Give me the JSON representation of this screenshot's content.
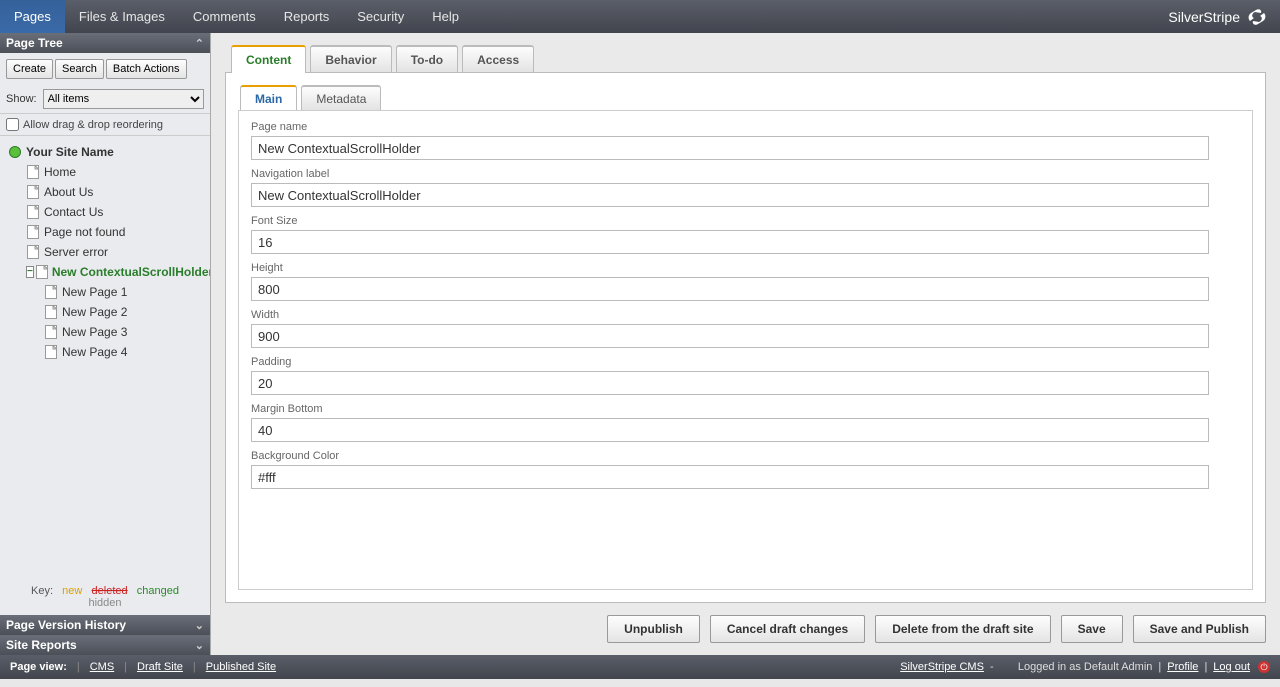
{
  "topmenu": {
    "items": [
      "Pages",
      "Files & Images",
      "Comments",
      "Reports",
      "Security",
      "Help"
    ],
    "brand": "SilverStripe"
  },
  "sidebar": {
    "panel_title": "Page Tree",
    "create_label": "Create",
    "search_label": "Search",
    "batch_label": "Batch Actions",
    "show_label": "Show:",
    "show_value": "All items",
    "allow_drag_label": "Allow drag & drop reordering",
    "tree": {
      "root": "Your Site Name",
      "children": [
        {
          "label": "Home"
        },
        {
          "label": "About Us"
        },
        {
          "label": "Contact Us"
        },
        {
          "label": "Page not found"
        },
        {
          "label": "Server error"
        },
        {
          "label": "New ContextualScrollHolder",
          "selected": true,
          "children": [
            {
              "label": "New Page 1"
            },
            {
              "label": "New Page 2"
            },
            {
              "label": "New Page 3"
            },
            {
              "label": "New Page 4"
            }
          ]
        }
      ]
    },
    "key_label": "Key:",
    "key_new": "new",
    "key_deleted": "deleted",
    "key_changed": "changed",
    "key_hidden": "hidden",
    "version_history": "Page Version History",
    "site_reports": "Site Reports"
  },
  "tabs": {
    "content": "Content",
    "behavior": "Behavior",
    "todo": "To-do",
    "access": "Access"
  },
  "subtabs": {
    "main": "Main",
    "metadata": "Metadata"
  },
  "form": {
    "fields": [
      {
        "label": "Page name",
        "value": "New ContextualScrollHolder"
      },
      {
        "label": "Navigation label",
        "value": "New ContextualScrollHolder"
      },
      {
        "label": "Font Size",
        "value": "16"
      },
      {
        "label": "Height",
        "value": "800"
      },
      {
        "label": "Width",
        "value": "900"
      },
      {
        "label": "Padding",
        "value": "20"
      },
      {
        "label": "Margin Bottom",
        "value": "40"
      },
      {
        "label": "Background Color",
        "value": "#fff"
      }
    ]
  },
  "buttons": {
    "unpublish": "Unpublish",
    "cancel": "Cancel draft changes",
    "delete": "Delete from the draft site",
    "save": "Save",
    "save_publish": "Save and Publish"
  },
  "statusbar": {
    "page_view": "Page view:",
    "cms": "CMS",
    "draft": "Draft Site",
    "published": "Published Site",
    "product": "SilverStripe CMS",
    "dash": "-",
    "logged_in": "Logged in as Default Admin",
    "profile": "Profile",
    "logout": "Log out"
  }
}
